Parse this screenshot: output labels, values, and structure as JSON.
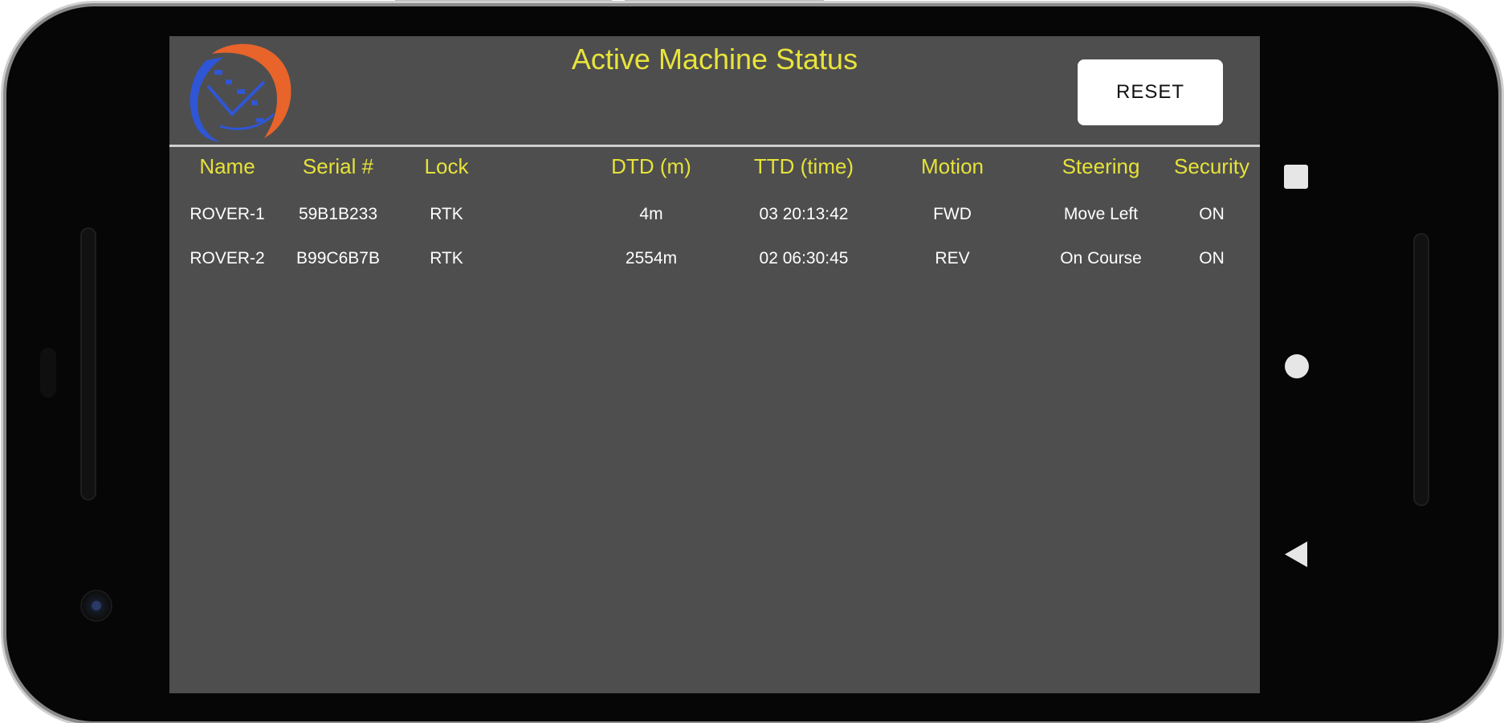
{
  "app": {
    "title": "Active Machine Status",
    "reset_label": "RESET"
  },
  "table": {
    "headers": [
      "Name",
      "Serial #",
      "Lock",
      "DTD (m)",
      "TTD (time)",
      "Motion",
      "Steering",
      "Security"
    ],
    "rows": [
      [
        "ROVER-1",
        "59B1B233",
        "RTK",
        "4m",
        "03 20:13:42",
        "FWD",
        "Move Left",
        "ON"
      ],
      [
        "ROVER-2",
        "B99C6B7B",
        "RTK",
        "2554m",
        "02 06:30:45",
        "REV",
        "On Course",
        "ON"
      ]
    ]
  },
  "colors": {
    "accent": "#e8e43c",
    "screen_bg": "#4e4e4e",
    "logo_orange": "#e8642a",
    "logo_blue": "#2f56d6"
  },
  "icons": {
    "logo": "company-logo",
    "nav_recents": "square-icon",
    "nav_home": "circle-icon",
    "nav_back": "back-triangle-icon"
  }
}
